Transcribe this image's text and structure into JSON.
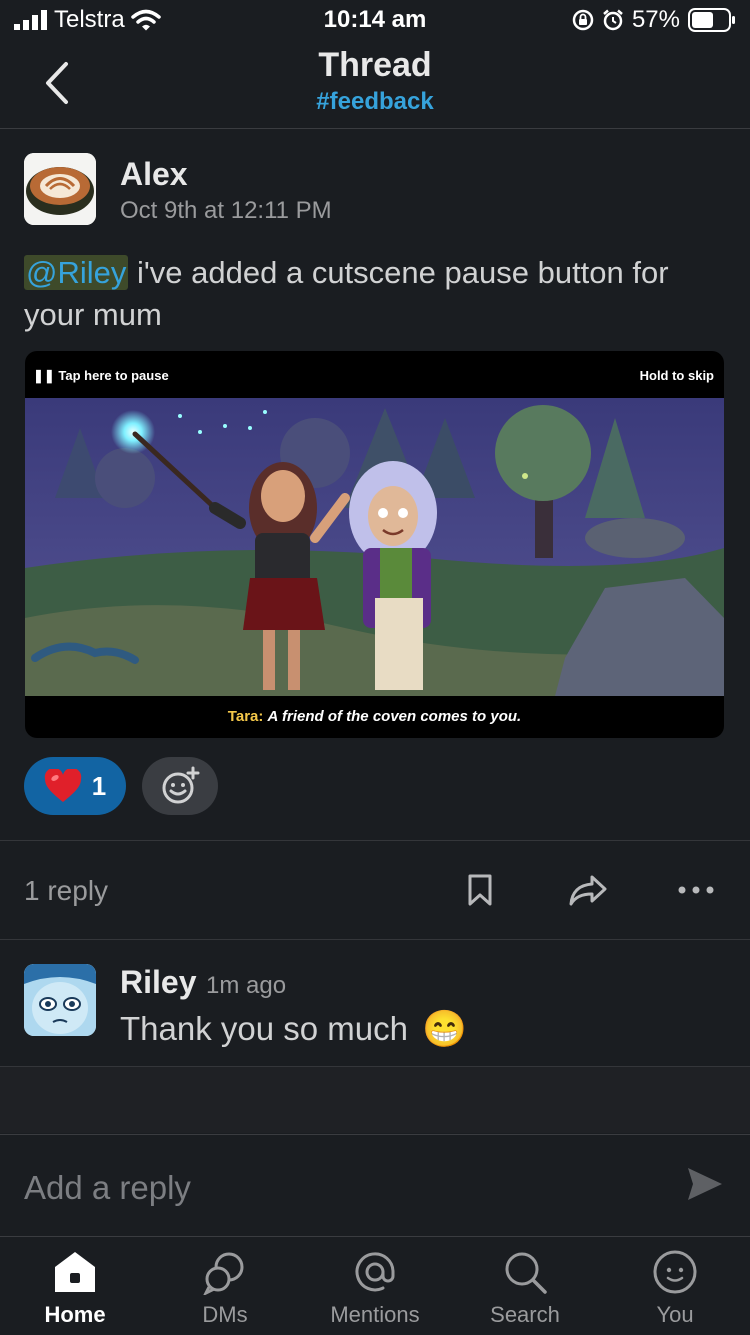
{
  "status_bar": {
    "carrier": "Telstra",
    "time": "10:14 am",
    "battery": "57%"
  },
  "header": {
    "title": "Thread",
    "channel": "#feedback"
  },
  "message": {
    "author": "Alex",
    "timestamp": "Oct 9th at 12:11 PM",
    "mention": "@Riley",
    "text": " i've added a cutscene pause button for your mum",
    "video": {
      "pause_hint": "Tap here to pause",
      "skip_hint": "Hold to skip",
      "speaker": "Tara:",
      "line": "A friend of the coven comes to you."
    },
    "reactions": [
      {
        "emoji": "❤️",
        "count": "1"
      }
    ]
  },
  "thread_actions": {
    "reply_count": "1 reply"
  },
  "reply": {
    "author": "Riley",
    "timestamp": "1m ago",
    "text": "Thank you so much",
    "emoji": "😁"
  },
  "composer": {
    "placeholder": "Add a reply"
  },
  "tabs": [
    {
      "label": "Home",
      "icon": "home-icon",
      "active": true
    },
    {
      "label": "DMs",
      "icon": "dms-icon",
      "active": false
    },
    {
      "label": "Mentions",
      "icon": "mentions-icon",
      "active": false
    },
    {
      "label": "Search",
      "icon": "search-icon",
      "active": false
    },
    {
      "label": "You",
      "icon": "you-icon",
      "active": false
    }
  ],
  "colors": {
    "background": "#1a1d21",
    "link": "#36a3dc",
    "reaction_active": "#1264a3",
    "subtitle_speaker": "#f4c84a"
  }
}
